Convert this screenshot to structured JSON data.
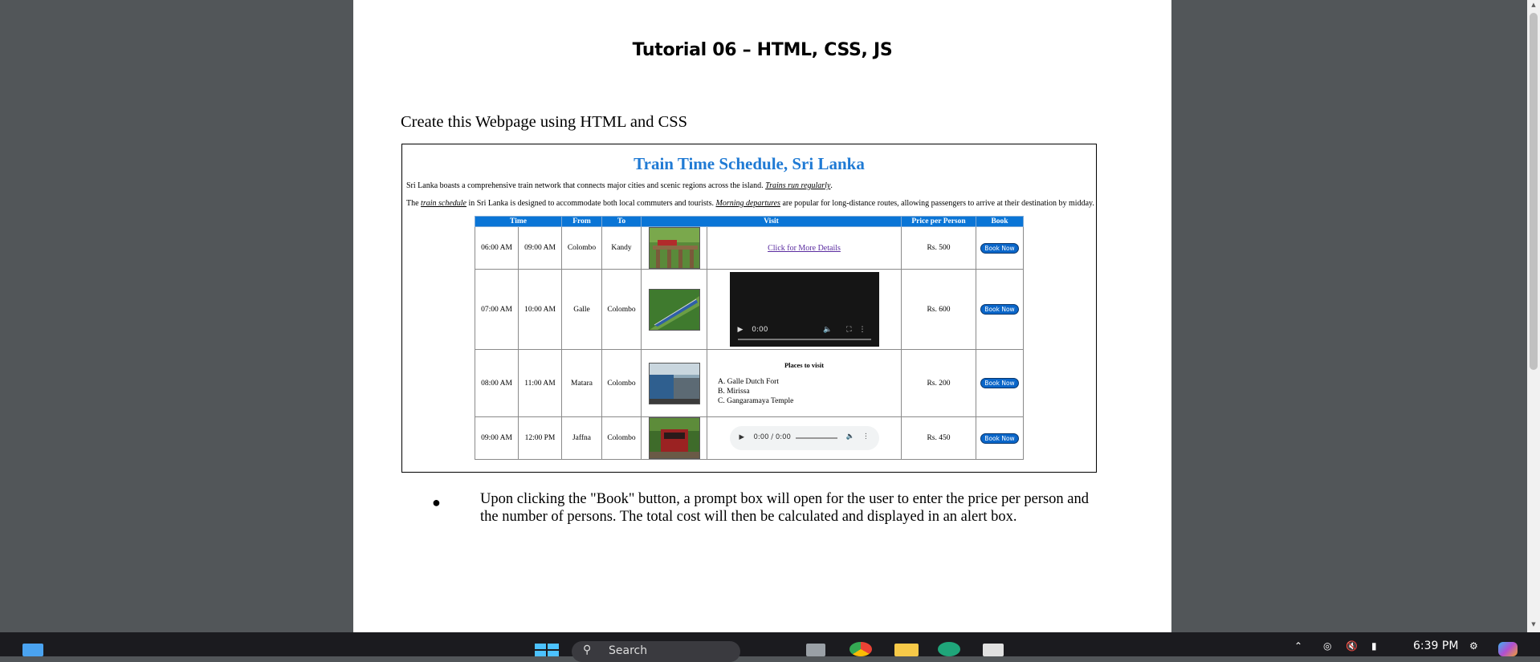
{
  "document": {
    "title": "Tutorial 06 – HTML, CSS, JS",
    "heading": "Create this Webpage using HTML and CSS",
    "bullet": "Upon clicking the \"Book\" button, a prompt box will open for the user to enter the price per person and the number of persons. The total cost will then be calculated and displayed in an alert box."
  },
  "webpage": {
    "title": "Train Time Schedule, Sri Lanka",
    "para1_text": "Sri Lanka boasts a comprehensive train network that connects major cities and scenic regions across the island.",
    "para1_link": "Trains run regularly",
    "para1_end": ".",
    "para2_start": "The",
    "para2_link1": "train schedule",
    "para2_middle": "in Sri Lanka is designed to accommodate both local commuters and tourists.",
    "para2_link2": "Morning departures",
    "para2_end": "are popular for long-distance routes, allowing passengers to arrive at their destination by midday.",
    "headers": {
      "time": "Time",
      "from": "From",
      "to": "To",
      "visit": "Visit",
      "price": "Price per Person",
      "book": "Book"
    },
    "rows": [
      {
        "depart": "06:00 AM",
        "arrive": "09:00 AM",
        "from": "Colombo",
        "to": "Kandy",
        "visit": "Click for More Details",
        "price": "Rs. 500"
      },
      {
        "depart": "07:00 AM",
        "arrive": "10:00 AM",
        "from": "Galle",
        "to": "Colombo",
        "video_time": "0:00",
        "price": "Rs. 600"
      },
      {
        "depart": "08:00 AM",
        "arrive": "11:00 AM",
        "from": "Matara",
        "to": "Colombo",
        "places_title": "Places to visit",
        "places": [
          "A. Galle Dutch Fort",
          "B. Mirissa",
          "C. Gangaramaya Temple"
        ],
        "price": "Rs. 200"
      },
      {
        "depart": "09:00 AM",
        "arrive": "12:00 PM",
        "from": "Jaffna",
        "to": "Colombo",
        "audio_time": "0:00 / 0:00",
        "price": "Rs. 450"
      }
    ],
    "book_label": "Book Now"
  },
  "taskbar": {
    "search_placeholder": "Search",
    "clock": "6:39 PM"
  },
  "colors": {
    "accent": "#1f7ad4",
    "header_bg": "#0a75d6",
    "viewer_bg": "#525659"
  }
}
